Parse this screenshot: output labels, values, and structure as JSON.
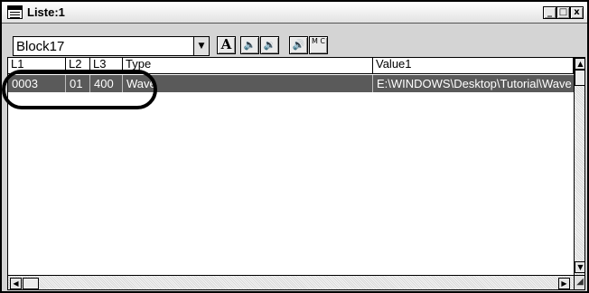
{
  "window": {
    "title": "Liste:1",
    "buttons": {
      "minimize": "_",
      "maximize": "□",
      "close": "x"
    }
  },
  "toolbar": {
    "combo_value": "Block17",
    "combo_arrow": "▼",
    "text_button": "A",
    "speaker1": "🔈",
    "speaker2": "🔉",
    "speaker3": "🔊",
    "mc_button": "M C"
  },
  "list": {
    "columns": [
      "L1",
      "L2",
      "L3",
      "Type",
      "Value1"
    ],
    "rows": [
      {
        "L1": "0003",
        "L2": "01",
        "L3": "400",
        "Type": "Wave",
        "Value1": "E:\\WINDOWS\\Desktop\\Tutorial\\Wave Fil"
      }
    ]
  },
  "scrollbars": {
    "up": "▲",
    "down": "▼",
    "left": "◀",
    "right": "▶",
    "grip": "◢"
  },
  "colors": {
    "selection": "#5a5a5a",
    "selection_text": "#ffffff",
    "background": "#d4d4d4"
  }
}
